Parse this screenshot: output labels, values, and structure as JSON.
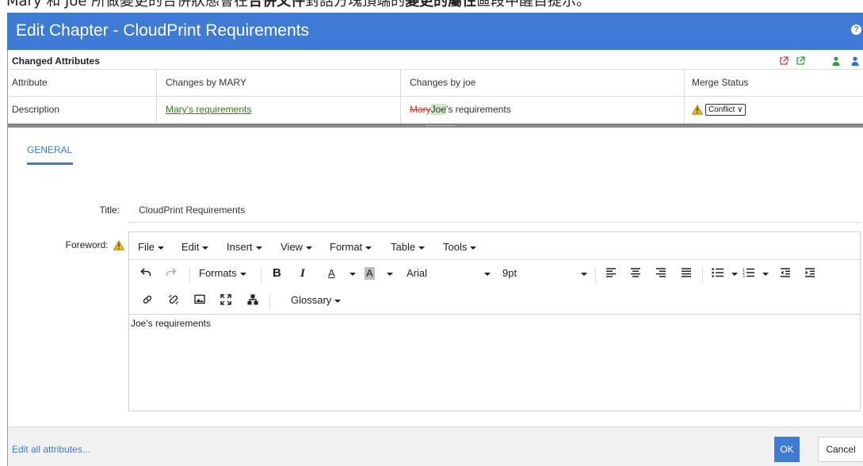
{
  "caption": {
    "text_prefix": "Mary 和 Joe 所做變更的合併狀態會在",
    "text_bold1": "合併文件",
    "text_mid": "對話方塊頂端的",
    "text_bold2": "變更的屬性",
    "text_suffix": "區段中醒目提示。"
  },
  "dialog": {
    "title": "Edit Chapter - CloudPrint Requirements",
    "help_icon": "help-icon"
  },
  "changed_attributes": {
    "title": "Changed Attributes",
    "columns": [
      "Attribute",
      "Changes by MARY",
      "Changes by joe",
      "Merge Status"
    ],
    "row": {
      "attribute": "Description",
      "mary_change": "Mary's requirements",
      "joe_strike": "Mary",
      "joe_highlight": "Joe",
      "joe_rest": "'s requirements",
      "merge_status": "Conflict"
    }
  },
  "tabs": {
    "general": "GENERAL"
  },
  "form": {
    "title_label": "Title:",
    "title_value": "CloudPrint Requirements",
    "foreword_label": "Foreword:"
  },
  "editor": {
    "menus": [
      "File",
      "Edit",
      "Insert",
      "View",
      "Format",
      "Table",
      "Tools"
    ],
    "formats_label": "Formats",
    "bold_label": "B",
    "italic_label": "I",
    "text_color_label": "A",
    "bg_color_label": "A",
    "font_family": "Arial",
    "font_size": "9pt",
    "glossary_label": "Glossary",
    "content": "Joe's requirements"
  },
  "footer": {
    "edit_all": "Edit all attributes...",
    "ok": "OK",
    "cancel": "Cancel"
  },
  "colors": {
    "accent": "#3e7bd4",
    "conflict_warning": "#f2c500",
    "mary_green": "#2f7d1b",
    "strike_red": "#c84040"
  }
}
